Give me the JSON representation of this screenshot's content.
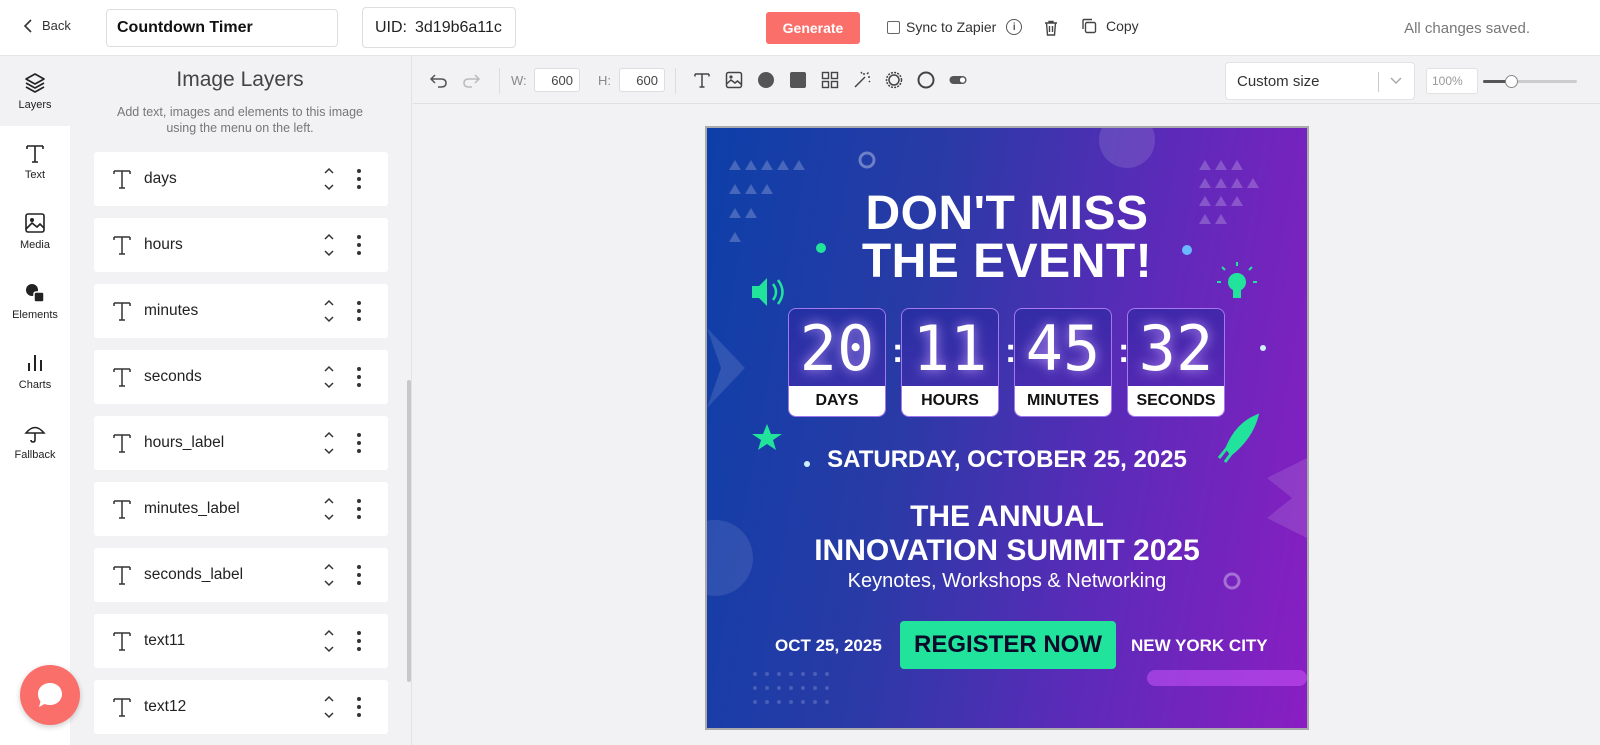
{
  "topbar": {
    "back_label": "Back",
    "title_value": "Countdown Timer",
    "uid_label": "UID:",
    "uid_value": "3d19b6a11c",
    "generate_label": "Generate",
    "sync_label": "Sync to Zapier",
    "copy_label": "Copy",
    "status": "All changes saved."
  },
  "nav": {
    "items": [
      {
        "label": "Layers",
        "icon": "layers-icon"
      },
      {
        "label": "Text",
        "icon": "text-icon"
      },
      {
        "label": "Media",
        "icon": "image-icon"
      },
      {
        "label": "Elements",
        "icon": "shapes-icon"
      },
      {
        "label": "Charts",
        "icon": "chart-icon"
      },
      {
        "label": "Fallback",
        "icon": "umbrella-icon"
      }
    ]
  },
  "layers_panel": {
    "title": "Image Layers",
    "subtitle": "Add text, images and elements to this image using the menu on the left.",
    "layers": [
      "days",
      "hours",
      "minutes",
      "seconds",
      "hours_label",
      "minutes_label",
      "seconds_label",
      "text11",
      "text12"
    ]
  },
  "toolbar": {
    "w_label": "W:",
    "w_value": "600",
    "h_label": "H:",
    "h_value": "600",
    "size_option": "Custom size",
    "zoom_value": "100%",
    "zoom_level": 0.3
  },
  "canvas": {
    "headline_1": "DON'T MISS",
    "headline_2": "THE EVENT!",
    "timer": [
      {
        "value": "20",
        "label": "DAYS"
      },
      {
        "value": "11",
        "label": "HOURS"
      },
      {
        "value": "45",
        "label": "MINUTES"
      },
      {
        "value": "32",
        "label": "SECONDS"
      }
    ],
    "colon": ":",
    "date": "SATURDAY, OCTOBER 25, 2025",
    "event_1": "THE ANNUAL",
    "event_2": "INNOVATION SUMMIT 2025",
    "tagline": "Keynotes, Workshops & Networking",
    "footer_date": "OCT 25, 2025",
    "register_label": "REGISTER NOW",
    "footer_city": "NEW YORK CITY"
  },
  "colors": {
    "accent": "#fb6f6b",
    "register_green": "#22e39b",
    "canvas_blue": "#0d3fa8",
    "canvas_purple": "#8a1ec2"
  }
}
